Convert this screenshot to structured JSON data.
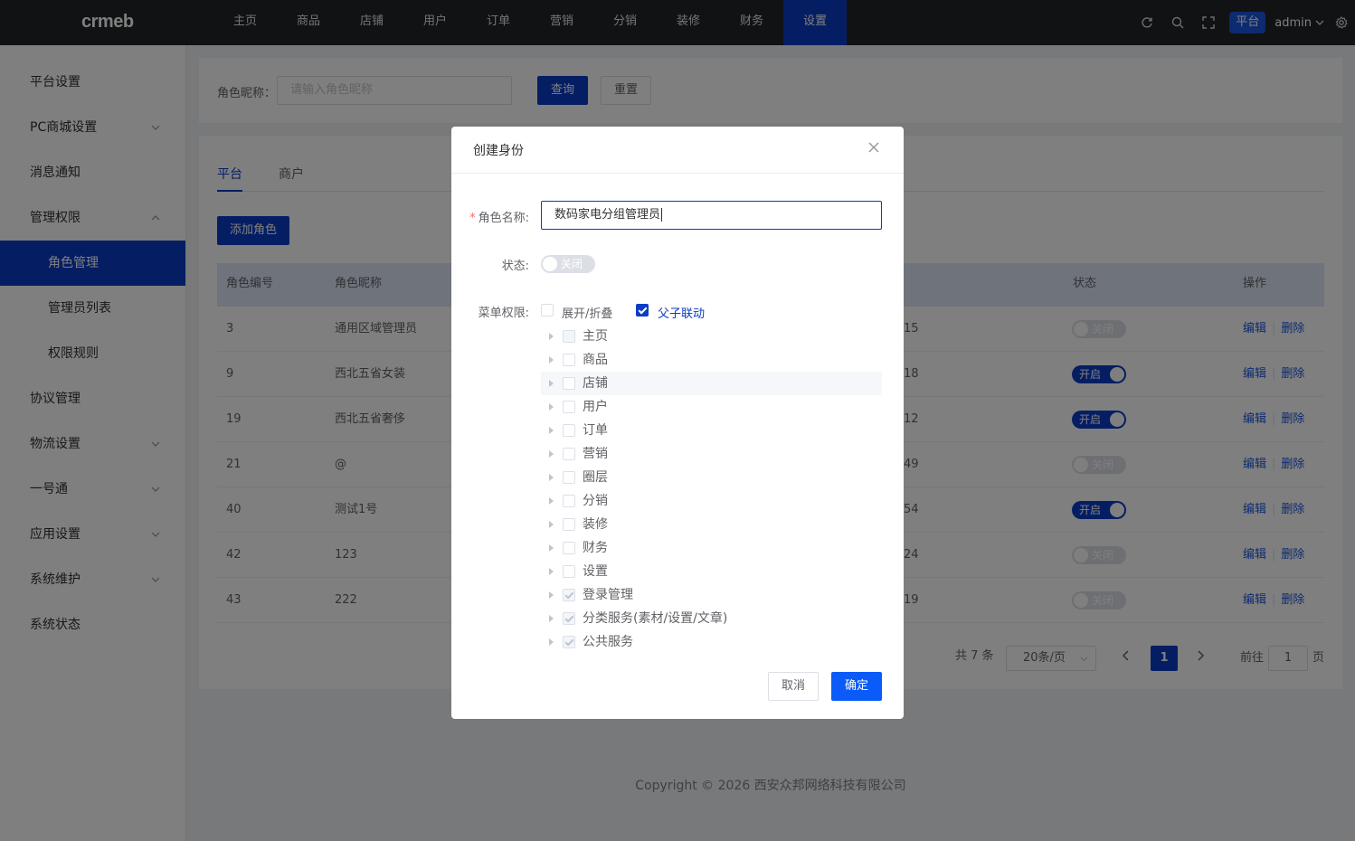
{
  "header": {
    "logo_text": "crmeb",
    "nav": [
      "主页",
      "商品",
      "店铺",
      "用户",
      "订单",
      "营销",
      "分销",
      "装修",
      "财务",
      "设置"
    ],
    "active_nav": "设置",
    "platform_badge": "平台",
    "user": "admin",
    "icons": [
      "refresh-icon",
      "search-icon",
      "fullscreen-icon",
      "settings-gear-icon"
    ]
  },
  "sidebar": {
    "items": [
      {
        "label": "平台设置",
        "expandable": false
      },
      {
        "label": "PC商城设置",
        "expandable": true
      },
      {
        "label": "消息通知",
        "expandable": false
      },
      {
        "label": "管理权限",
        "expandable": true,
        "expanded": true
      },
      {
        "label": "角色管理",
        "sub": true,
        "active": true
      },
      {
        "label": "管理员列表",
        "sub": true
      },
      {
        "label": "权限规则",
        "sub": true
      },
      {
        "label": "协议管理",
        "expandable": false
      },
      {
        "label": "物流设置",
        "expandable": true
      },
      {
        "label": "一号通",
        "expandable": true
      },
      {
        "label": "应用设置",
        "expandable": true
      },
      {
        "label": "系统维护",
        "expandable": true
      },
      {
        "label": "系统状态",
        "expandable": false
      }
    ]
  },
  "search": {
    "label": "角色昵称：",
    "placeholder": "请输入角色昵称",
    "query_button": "查询",
    "reset_button": "重置"
  },
  "tabs": [
    "平台",
    "商户"
  ],
  "add_role_button": "添加角色",
  "table": {
    "headers": {
      "id": "角色编号",
      "name": "角色昵称",
      "status": "状态",
      "ops": "操作"
    },
    "rows": [
      {
        "id": "3",
        "name": "通用区域管理员",
        "time_tail": "15",
        "status": "关闭",
        "on": false
      },
      {
        "id": "9",
        "name": "西北五省女装",
        "time_tail": "18",
        "status": "开启",
        "on": true
      },
      {
        "id": "19",
        "name": "西北五省奢侈",
        "time_tail": "12",
        "status": "开启",
        "on": true
      },
      {
        "id": "21",
        "name": "@",
        "time_tail": "49",
        "status": "关闭",
        "on": false
      },
      {
        "id": "40",
        "name": "测试1号",
        "time_tail": "54",
        "status": "开启",
        "on": true
      },
      {
        "id": "42",
        "name": "123",
        "time_tail": "24",
        "status": "关闭",
        "on": false
      },
      {
        "id": "43",
        "name": "222",
        "time_tail": "19",
        "status": "关闭",
        "on": false
      }
    ],
    "edit_label": "编辑",
    "delete_label": "删除"
  },
  "pagination": {
    "total": "共 7 条",
    "page_size": "20条/页",
    "current_page": "1",
    "goto_prefix": "前往",
    "goto_value": "1",
    "goto_suffix": "页"
  },
  "footer": "Copyright © 2026 西安众邦网络科技有限公司",
  "dialog": {
    "title": "创建身份",
    "name_label": "角色名称:",
    "name_value": "数码家电分组管理员",
    "status_label": "状态:",
    "status_value": "关闭",
    "menu_label": "菜单权限:",
    "expand_collapse": "展开/折叠",
    "parent_child_link": "父子联动",
    "parent_child_checked": true,
    "tree": [
      {
        "label": "主页",
        "state": "disabled"
      },
      {
        "label": "商品",
        "state": "unchecked"
      },
      {
        "label": "店铺",
        "state": "unchecked",
        "hover": true
      },
      {
        "label": "用户",
        "state": "unchecked"
      },
      {
        "label": "订单",
        "state": "unchecked"
      },
      {
        "label": "营销",
        "state": "unchecked"
      },
      {
        "label": "圈层",
        "state": "unchecked"
      },
      {
        "label": "分销",
        "state": "unchecked"
      },
      {
        "label": "装修",
        "state": "unchecked"
      },
      {
        "label": "财务",
        "state": "unchecked"
      },
      {
        "label": "设置",
        "state": "unchecked"
      },
      {
        "label": "登录管理",
        "state": "disabled-checked"
      },
      {
        "label": "分类服务(素材/设置/文章)",
        "state": "disabled-checked"
      },
      {
        "label": "公共服务",
        "state": "disabled-checked"
      }
    ],
    "cancel_button": "取消",
    "confirm_button": "确定"
  },
  "colors": {
    "primary": "#0a3cc7",
    "topbar": "#232427",
    "confirm": "#0a5bf7"
  }
}
